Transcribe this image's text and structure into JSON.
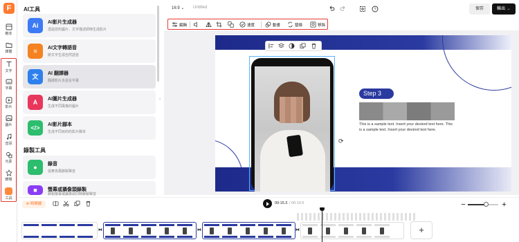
{
  "app": {
    "logo_letter": "F"
  },
  "rail": {
    "items": [
      {
        "label": "範本",
        "icon": "template-icon"
      },
      {
        "label": "媒體",
        "icon": "folder-icon"
      },
      {
        "label": "文字",
        "icon": "text-icon"
      },
      {
        "label": "字幕",
        "icon": "subtitle-icon"
      },
      {
        "label": "影片",
        "icon": "video-icon"
      },
      {
        "label": "圖片",
        "icon": "image-icon"
      },
      {
        "label": "音訊",
        "icon": "music-icon"
      },
      {
        "label": "元素",
        "icon": "elements-icon"
      },
      {
        "label": "轉場",
        "icon": "transition-icon"
      },
      {
        "label": "工具",
        "icon": "toolbox-icon"
      }
    ]
  },
  "panel": {
    "ai_section_title": "AI工具",
    "rec_section_title": "錄製工具",
    "ai_tools": [
      {
        "name": "AI影片生成器",
        "desc": "透過您的圖片、文字描述即時生成影片",
        "color": "#3d7bf5",
        "glyph": "Ai"
      },
      {
        "name": "AI文字轉語音",
        "desc": "將文字生成自然語音",
        "color": "#f58220",
        "glyph": "≡"
      },
      {
        "name": "AI 翻譯器",
        "desc": "翻譯影片多語言字幕",
        "color": "#2f80ed",
        "glyph": "文"
      },
      {
        "name": "AI圖片生成器",
        "desc": "生成不同風格的圖片",
        "color": "#e8365d",
        "glyph": "A"
      },
      {
        "name": "AI影片腳本",
        "desc": "生成不同目的的影片腳本",
        "color": "#2dbd6e",
        "glyph": "</>"
      }
    ],
    "rec_tools": [
      {
        "name": "錄音",
        "desc": "從麥克風錄製聲音",
        "color": "#2dbd6e",
        "glyph": "●"
      },
      {
        "name": "螢幕或攝像頭錄製",
        "desc": "錄製螢幕或攝像頭同時錄製聲音",
        "color": "#8a3df5",
        "glyph": "■"
      }
    ]
  },
  "topbar": {
    "aspect": "16:9 ⌄",
    "doc_title": "Untitled",
    "save_label": "保存",
    "export_label": "輸出 →"
  },
  "edit_toolbar": {
    "edit_label": "編輯",
    "speed_label": "速度",
    "animation_label": "動畫",
    "replace_label": "替換",
    "remove_label": "移除"
  },
  "slide": {
    "step_label": "Step 3",
    "body_text": "This is a sample text. Insert your desired text here. This is a sample text. Insert your desired text here."
  },
  "timeline": {
    "tag_label": "⊕ 時間線",
    "current_time": "00:15.3",
    "total_time": "/ 00:19.5",
    "zoom_level": 0.6,
    "add_label": "+"
  },
  "colors": {
    "accent": "#ff7a2f",
    "slide_blue": "#2a3aa0",
    "highlight_red": "#e53935"
  }
}
